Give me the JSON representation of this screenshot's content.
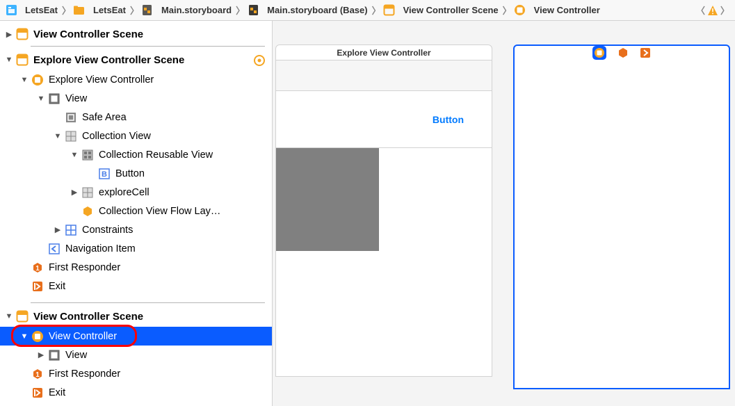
{
  "breadcrumb": {
    "items": [
      {
        "label": "LetsEat",
        "icon": "project"
      },
      {
        "label": "LetsEat",
        "icon": "folder"
      },
      {
        "label": "Main.storyboard",
        "icon": "storyboard-file"
      },
      {
        "label": "Main.storyboard (Base)",
        "icon": "storyboard-dark"
      },
      {
        "label": "View Controller Scene",
        "icon": "scene"
      },
      {
        "label": "View Controller",
        "icon": "viewcontroller"
      }
    ]
  },
  "outline": {
    "scenes": [
      {
        "title": "View Controller Scene",
        "collapsed": true
      },
      {
        "title": "Explore View Controller Scene",
        "has_target": true,
        "children": [
          {
            "label": "Explore View Controller",
            "icon": "viewcontroller",
            "expanded": true,
            "children": [
              {
                "label": "View",
                "icon": "view",
                "expanded": true,
                "children": [
                  {
                    "label": "Safe Area",
                    "icon": "safearea",
                    "leaf": true
                  },
                  {
                    "label": "Collection View",
                    "icon": "collectionview",
                    "expanded": true,
                    "children": [
                      {
                        "label": "Collection Reusable View",
                        "icon": "reusableview",
                        "expanded": true,
                        "children": [
                          {
                            "label": "Button",
                            "icon": "button",
                            "leaf": true
                          }
                        ]
                      },
                      {
                        "label": "exploreCell",
                        "icon": "collectioncell",
                        "collapsed": true
                      },
                      {
                        "label": "Collection View Flow Lay…",
                        "icon": "flowlayout",
                        "leaf": true
                      }
                    ]
                  },
                  {
                    "label": "Constraints",
                    "icon": "constraints",
                    "collapsed": true
                  }
                ]
              },
              {
                "label": "Navigation Item",
                "icon": "navitem",
                "leaf": true
              }
            ]
          },
          {
            "label": "First Responder",
            "icon": "firstresponder",
            "leaf": true
          },
          {
            "label": "Exit",
            "icon": "exit",
            "leaf": true
          }
        ]
      },
      {
        "title": "View Controller Scene",
        "children": [
          {
            "label": "View Controller",
            "icon": "viewcontroller",
            "expanded": true,
            "selected": true,
            "highlight": true,
            "children": [
              {
                "label": "View",
                "icon": "view",
                "collapsed": true
              }
            ]
          },
          {
            "label": "First Responder",
            "icon": "firstresponder",
            "leaf": true
          },
          {
            "label": "Exit",
            "icon": "exit",
            "leaf": true
          }
        ]
      }
    ]
  },
  "canvas": {
    "left": {
      "title": "Explore View Controller",
      "button_label": "Button"
    }
  }
}
